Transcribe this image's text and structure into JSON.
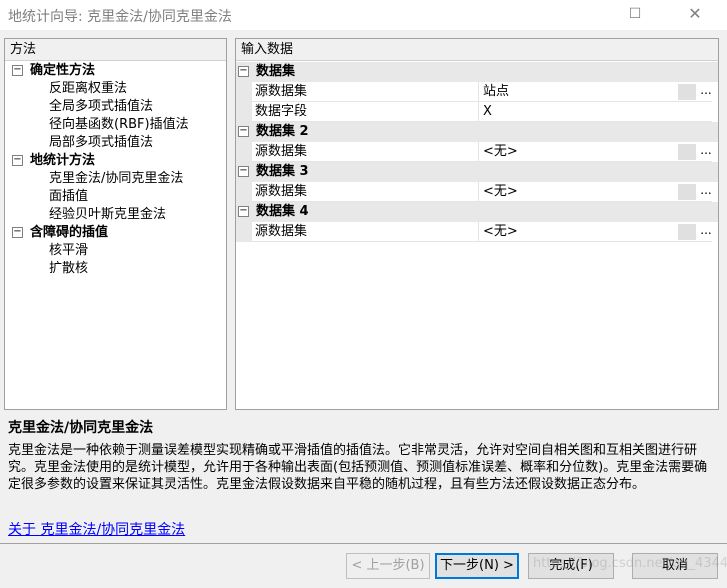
{
  "window": {
    "title": "地统计向导: 克里金法/协同克里金法",
    "maximize_glyph": "☐",
    "close_glyph": "✕"
  },
  "methods_panel": {
    "header": "方法",
    "categories": [
      {
        "label": "确定性方法",
        "toggle": "−",
        "items": [
          "反距离权重法",
          "全局多项式插值法",
          "径向基函数(RBF)插值法",
          "局部多项式插值法"
        ]
      },
      {
        "label": "地统计方法",
        "toggle": "−",
        "items": [
          "克里金法/协同克里金法",
          "面插值",
          "经验贝叶斯克里金法"
        ]
      },
      {
        "label": "含障碍的插值",
        "toggle": "−",
        "items": [
          "核平滑",
          "扩散核"
        ]
      }
    ]
  },
  "input_panel": {
    "header": "输入数据",
    "datasets": [
      {
        "label": "数据集",
        "toggle": "−",
        "props": [
          {
            "name": "源数据集",
            "value": "站点",
            "has_button": true
          },
          {
            "name": "数据字段",
            "value": "X",
            "has_button": false
          }
        ]
      },
      {
        "label": "数据集 2",
        "toggle": "−",
        "props": [
          {
            "name": "源数据集",
            "value": "<无>",
            "has_button": true
          }
        ]
      },
      {
        "label": "数据集 3",
        "toggle": "−",
        "props": [
          {
            "name": "源数据集",
            "value": "<无>",
            "has_button": true
          }
        ]
      },
      {
        "label": "数据集 4",
        "toggle": "−",
        "props": [
          {
            "name": "源数据集",
            "value": "<无>",
            "has_button": true
          }
        ]
      }
    ],
    "ellipsis": "..."
  },
  "description": {
    "title": "克里金法/协同克里金法",
    "text": "克里金法是一种依赖于测量误差模型实现精确或平滑插值的插值法。它非常灵活，允许对空间自相关图和互相关图进行研究。克里金法使用的是统计模型，允许用于各种输出表面(包括预测值、预测值标准误差、概率和分位数)。克里金法需要确定很多参数的设置来保证其灵活性。克里金法假设数据来自平稳的随机过程，且有些方法还假设数据正态分布。",
    "link": "关于 克里金法/协同克里金法"
  },
  "buttons": {
    "back": "< 上一步(B)",
    "next": "下一步(N) >",
    "finish": "完成(F)",
    "cancel": "取消"
  },
  "watermark": "https://blog.csdn.net/qq_43441159"
}
